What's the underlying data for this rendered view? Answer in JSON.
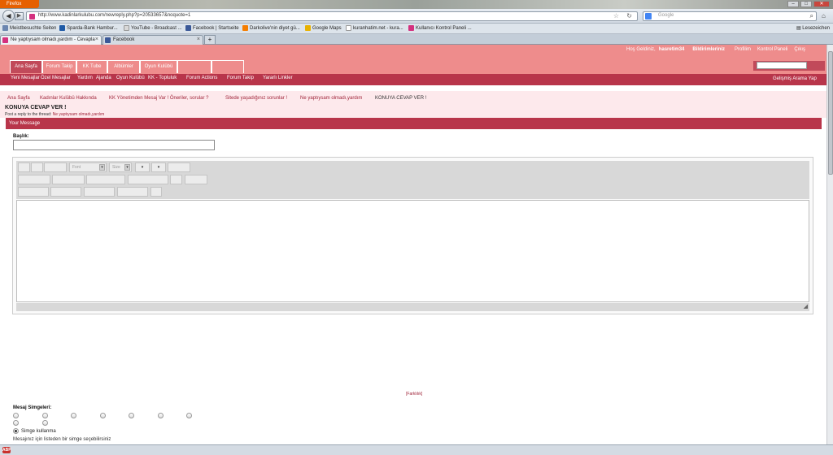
{
  "browser": {
    "app_button": "Firefox",
    "url": "http://www.kadinlarkulubu.com/newreply.php?p=20533657&noquote=1",
    "search_placeholder": "Google",
    "bookmarks": [
      {
        "label": "Meistbesuchte Seiten",
        "color": "#6b86b0"
      },
      {
        "label": "Sparda-Bank Hambur...",
        "color": "#1f5aa6"
      },
      {
        "label": "YouTube - Broadcast ...",
        "color": "#d8d8d8"
      },
      {
        "label": "Facebook | Startseite",
        "color": "#3b5998"
      },
      {
        "label": "Darkolive'nin diyet gü...",
        "color": "#f57d00"
      },
      {
        "label": "Google Maps",
        "color": "#e8b100"
      },
      {
        "label": "kuranhatim.net - kura...",
        "color": "#ffffff"
      },
      {
        "label": "Kullanıcı Kontrol Paneli ...",
        "color": "#d4317f"
      }
    ],
    "bookmarks_right": "Lesezeichen",
    "tabs": [
      {
        "label": "Ne yaptıysam olmadı,yardım - Cevapla",
        "color": "#d4317f"
      },
      {
        "label": "Facebook",
        "color": "#3b5998"
      }
    ],
    "new_tab": "+"
  },
  "header": {
    "welcome": "Hoş Geldiniz,",
    "username": "hasretim34",
    "notifications": "Bildirimleriniz",
    "links": [
      "Profilim",
      "Kontrol Paneli",
      "Çıkış"
    ],
    "nav_tabs": [
      "Ana Sayfa",
      "Forum Takip",
      "KK Tube",
      "Albümler",
      "Oyun Kulübü",
      ""
    ],
    "subnav": [
      "Yeni Mesajlar",
      "Özel Mesajlar",
      "Yardım",
      "Ajanda",
      "Oyun Kulübü",
      "KK - Topluluk",
      "Forum Actions",
      "Forum Takip",
      "Yararlı Linkler"
    ],
    "advanced_search": "Gelişmiş Arama Yap"
  },
  "breadcrumb": [
    "Ana Sayfa",
    "Kadınlar Kulübü Hakkında",
    "KK Yönetimden Mesaj Var ! Öneriler, sorular ?",
    "Sitede yaşadığınız sorunlar !",
    "Ne yaptıysam olmadı,yardım",
    "KONUYA CEVAP VER !"
  ],
  "page_title": "KONUYA CEVAP VER !",
  "reply_to_prefix": "Post a reply to the thread:",
  "reply_to_thread": "Ne yaptıysam olmadı,yardım",
  "message_section": "Your Message",
  "title_label": "Başlık:",
  "editor": {
    "font_label": "Font",
    "size_label": "Size",
    "resize_glyph": "◢"
  },
  "preview": {
    "left": "[",
    "label": "Farklılık",
    "right": "]"
  },
  "smilies_label": "Mesaj Simgeleri:",
  "no_smiley_label": "Simge kullanma",
  "smiley_hint": "Mesajınız için listeden bir simge seçebilirsiniz",
  "status": {
    "abp": "ABP"
  }
}
